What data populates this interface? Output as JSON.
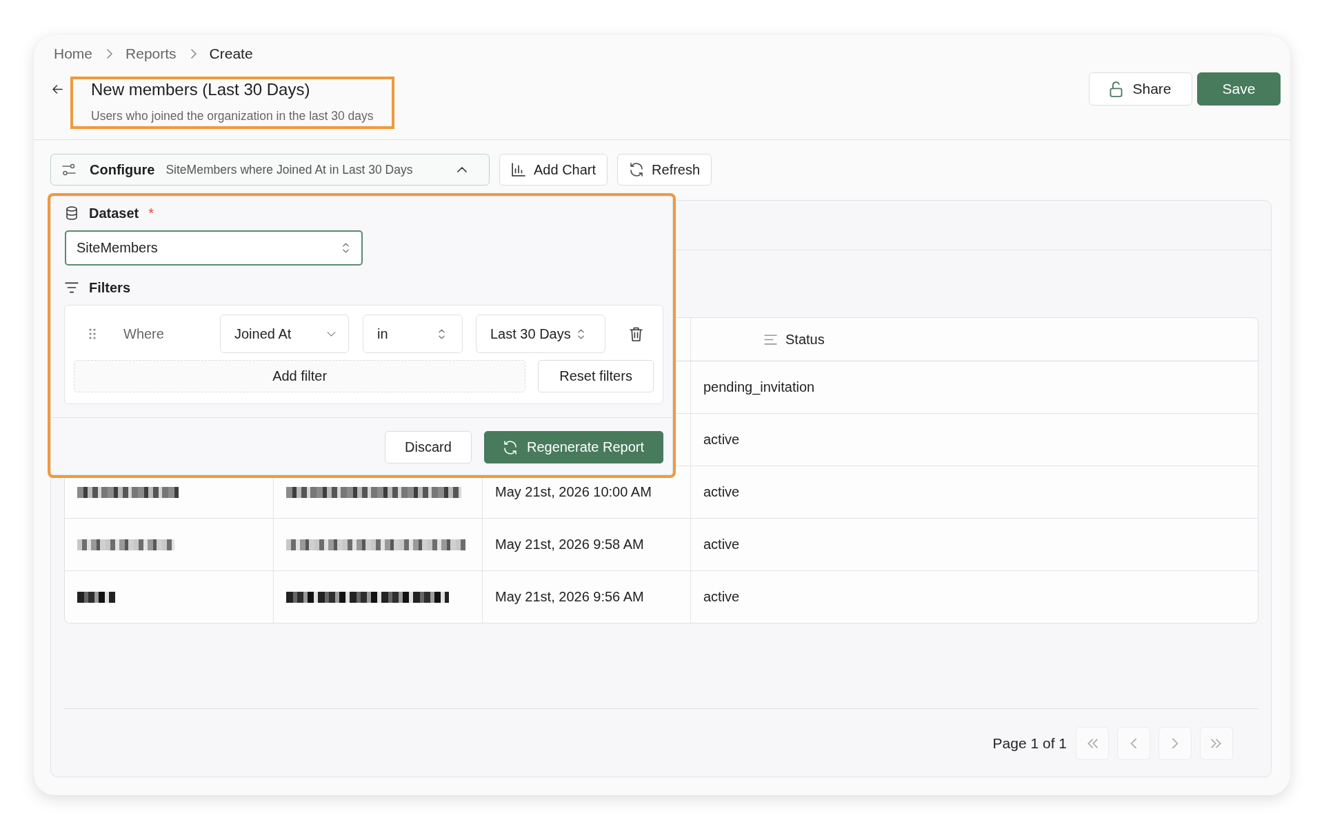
{
  "breadcrumb": [
    {
      "label": "Home",
      "current": false
    },
    {
      "label": "Reports",
      "current": false
    },
    {
      "label": "Create",
      "current": true
    }
  ],
  "header": {
    "title": "New members (Last 30 Days)",
    "description": "Users who joined the organization in the last 30 days",
    "highlighted": true
  },
  "actions": [
    {
      "label": "Share",
      "kind": "secondary"
    },
    {
      "label": "Save",
      "kind": "primary"
    }
  ],
  "toolbar": {
    "configure": {
      "label": "Configure",
      "summary": "SiteMembers where Joined At in Last 30 Days",
      "expanded": true
    },
    "buttons": [
      {
        "label": "Add Chart",
        "kind": "chart"
      },
      {
        "label": "Refresh",
        "kind": "refresh"
      }
    ]
  },
  "config_panel": {
    "highlighted": true,
    "dataset": {
      "label": "Dataset",
      "required_mark": "*",
      "value": "SiteMembers",
      "focused": true
    },
    "filters": {
      "label": "Filters",
      "conditions": [
        {
          "connector": "Where",
          "parts": [
            {
              "kind": "dropdown",
              "value": "Joined At"
            },
            {
              "kind": "select",
              "value": "in"
            },
            {
              "kind": "select",
              "value": "Last 30 Days"
            }
          ]
        }
      ],
      "add_label": "Add filter",
      "reset_label": "Reset filters"
    },
    "buttons": [
      {
        "label": "Discard",
        "kind": "secondary"
      },
      {
        "label": "Regenerate Report",
        "kind": "primary"
      }
    ]
  },
  "table": {
    "columns": [
      {
        "kind": "covered"
      },
      {
        "kind": "covered"
      },
      {
        "kind": "covered"
      },
      {
        "kind": "text",
        "label": "Status"
      }
    ],
    "rows": [
      {
        "cells": [
          {
            "kind": "covered"
          },
          {
            "kind": "covered"
          },
          {
            "kind": "covered"
          },
          {
            "kind": "text",
            "text": "pending_invitation"
          }
        ]
      },
      {
        "cells": [
          {
            "kind": "covered"
          },
          {
            "kind": "covered"
          },
          {
            "kind": "covered"
          },
          {
            "kind": "text",
            "text": "active"
          }
        ]
      },
      {
        "cells": [
          {
            "kind": "pixelated"
          },
          {
            "kind": "pixelated"
          },
          {
            "kind": "text",
            "text": "May 21st, 2026 10:00 AM"
          },
          {
            "kind": "text",
            "text": "active"
          }
        ]
      },
      {
        "cells": [
          {
            "kind": "pixelated"
          },
          {
            "kind": "pixelated"
          },
          {
            "kind": "text",
            "text": "May 21st, 2026 9:58 AM"
          },
          {
            "kind": "text",
            "text": "active"
          }
        ]
      },
      {
        "cells": [
          {
            "kind": "pixelated"
          },
          {
            "kind": "pixelated"
          },
          {
            "kind": "text",
            "text": "May 21st, 2026 9:56 AM"
          },
          {
            "kind": "text",
            "text": "active"
          }
        ]
      }
    ]
  },
  "pagination": {
    "label": "Page 1 of 1",
    "buttons": [
      {
        "kind": "first",
        "disabled": true
      },
      {
        "kind": "previous",
        "disabled": true
      },
      {
        "kind": "next",
        "disabled": true
      },
      {
        "kind": "last",
        "disabled": true
      }
    ]
  }
}
